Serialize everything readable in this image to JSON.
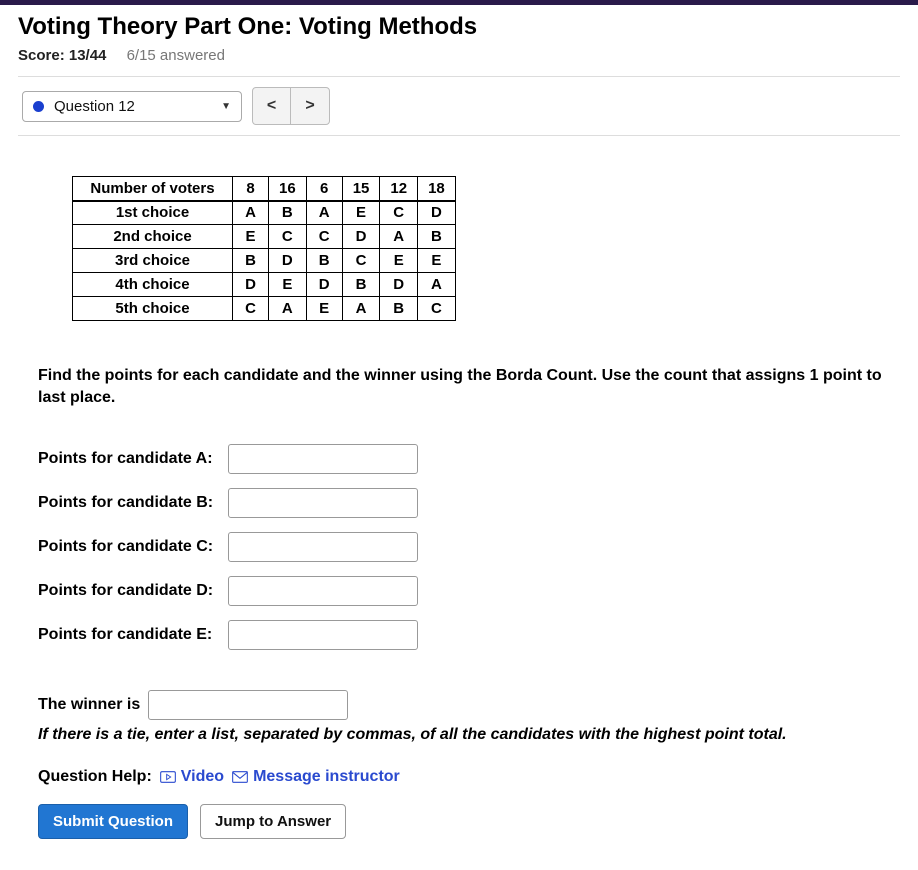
{
  "header": {
    "title": "Voting Theory Part One: Voting Methods",
    "score_label": "Score: 13/44",
    "answered_label": "6/15 answered"
  },
  "nav": {
    "question_label": "Question 12",
    "prev": "<",
    "next": ">"
  },
  "table": {
    "row_header": "Number of voters",
    "voters": [
      "8",
      "16",
      "6",
      "15",
      "12",
      "18"
    ],
    "rows": [
      {
        "label": "1st choice",
        "cells": [
          "A",
          "B",
          "A",
          "E",
          "C",
          "D"
        ]
      },
      {
        "label": "2nd choice",
        "cells": [
          "E",
          "C",
          "C",
          "D",
          "A",
          "B"
        ]
      },
      {
        "label": "3rd choice",
        "cells": [
          "B",
          "D",
          "B",
          "C",
          "E",
          "E"
        ]
      },
      {
        "label": "4th choice",
        "cells": [
          "D",
          "E",
          "D",
          "B",
          "D",
          "A"
        ]
      },
      {
        "label": "5th choice",
        "cells": [
          "C",
          "A",
          "E",
          "A",
          "B",
          "C"
        ]
      }
    ]
  },
  "prompt": "Find the points for each candidate and the winner using the Borda Count. Use the count that assigns 1 point to last place.",
  "answers": {
    "labels": [
      "Points for candidate A:",
      "Points for candidate B:",
      "Points for candidate C:",
      "Points for candidate D:",
      "Points for candidate E:"
    ]
  },
  "winner": {
    "label": "The winner is",
    "tie_note": "If there is a tie, enter a list, separated by commas, of all the candidates with the highest point total."
  },
  "help": {
    "label": "Question Help:",
    "video": "Video",
    "message": "Message instructor"
  },
  "buttons": {
    "submit": "Submit Question",
    "jump": "Jump to Answer"
  }
}
